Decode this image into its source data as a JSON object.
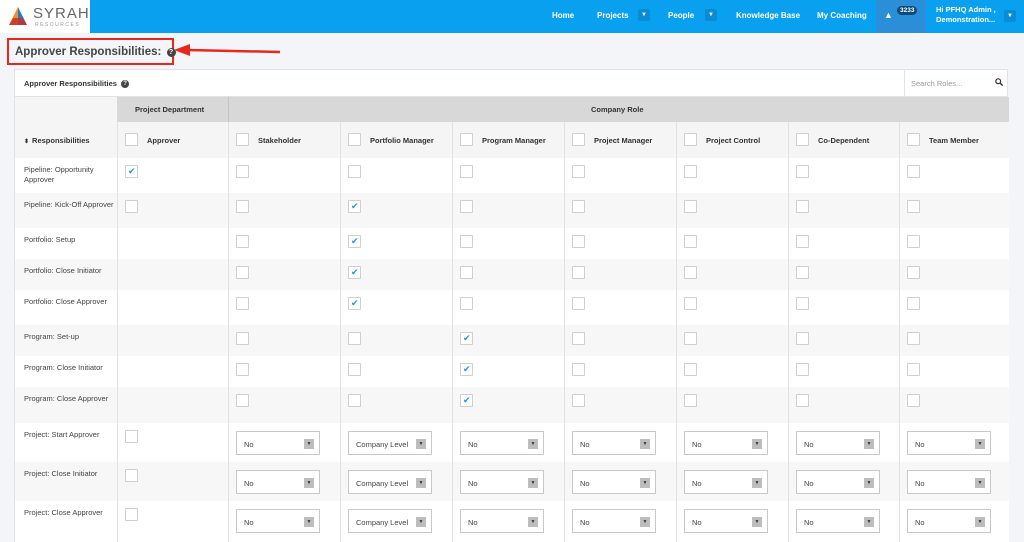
{
  "brand": {
    "name": "SYRAH",
    "sub": "RESOURCES"
  },
  "nav": {
    "home": "Home",
    "projects": "Projects",
    "people": "People",
    "knowledge_base": "Knowledge Base",
    "my_coaching": "My Coaching",
    "alert_count": "3233",
    "user_line1": "Hi PFHQ Admin ,",
    "user_line2": "Demonstration..."
  },
  "page": {
    "title": "Approver Responsibilities:"
  },
  "panel": {
    "title": "Approver Responsibilities",
    "search_placeholder": "Search Roles..."
  },
  "table": {
    "group_project_department": "Project Department",
    "group_company_role": "Company Role",
    "responsibilities_header": "Responsibilities",
    "columns": [
      "Approver",
      "Stakeholder",
      "Portfolio Manager",
      "Program Manager",
      "Project Manager",
      "Project Control",
      "Co-Dependent",
      "Team Member"
    ],
    "rows": [
      {
        "label": "Pipeline: Opportunity Approver",
        "type": "check",
        "dept": true,
        "roles": [
          false,
          false,
          false,
          false,
          false,
          false,
          false
        ]
      },
      {
        "label": "Pipeline: Kick-Off Approver",
        "type": "check",
        "dept": false,
        "roles": [
          false,
          true,
          false,
          false,
          false,
          false,
          false
        ]
      },
      {
        "label": "Portfolio: Setup",
        "type": "check",
        "dept": null,
        "roles": [
          false,
          true,
          false,
          false,
          false,
          false,
          false
        ]
      },
      {
        "label": "Portfolio: Close Initiator",
        "type": "check",
        "dept": null,
        "roles": [
          false,
          true,
          false,
          false,
          false,
          false,
          false
        ]
      },
      {
        "label": "Portfolio: Close Approver",
        "type": "check",
        "dept": null,
        "roles": [
          false,
          true,
          false,
          false,
          false,
          false,
          false
        ]
      },
      {
        "label": "Program: Set-up",
        "type": "check",
        "dept": null,
        "roles": [
          false,
          false,
          true,
          false,
          false,
          false,
          false
        ]
      },
      {
        "label": "Program: Close Initiator",
        "type": "check",
        "dept": null,
        "roles": [
          false,
          false,
          true,
          false,
          false,
          false,
          false
        ]
      },
      {
        "label": "Program: Close Approver",
        "type": "check",
        "dept": null,
        "roles": [
          false,
          false,
          true,
          false,
          false,
          false,
          false
        ]
      },
      {
        "label": "Project: Start Approver",
        "type": "select",
        "dept": false,
        "roles": [
          "No",
          "Company Level",
          "No",
          "No",
          "No",
          "No",
          "No"
        ]
      },
      {
        "label": "Project: Close Initiator",
        "type": "select",
        "dept": false,
        "roles": [
          "No",
          "Company Level",
          "No",
          "No",
          "No",
          "No",
          "No"
        ]
      },
      {
        "label": "Project: Close Approver",
        "type": "select",
        "dept": false,
        "roles": [
          "No",
          "Company Level",
          "No",
          "No",
          "No",
          "No",
          "No"
        ]
      }
    ]
  },
  "colors": {
    "nav_bg": "#0aa0f0",
    "check": "#1597e8",
    "highlight": "#e8281c"
  }
}
